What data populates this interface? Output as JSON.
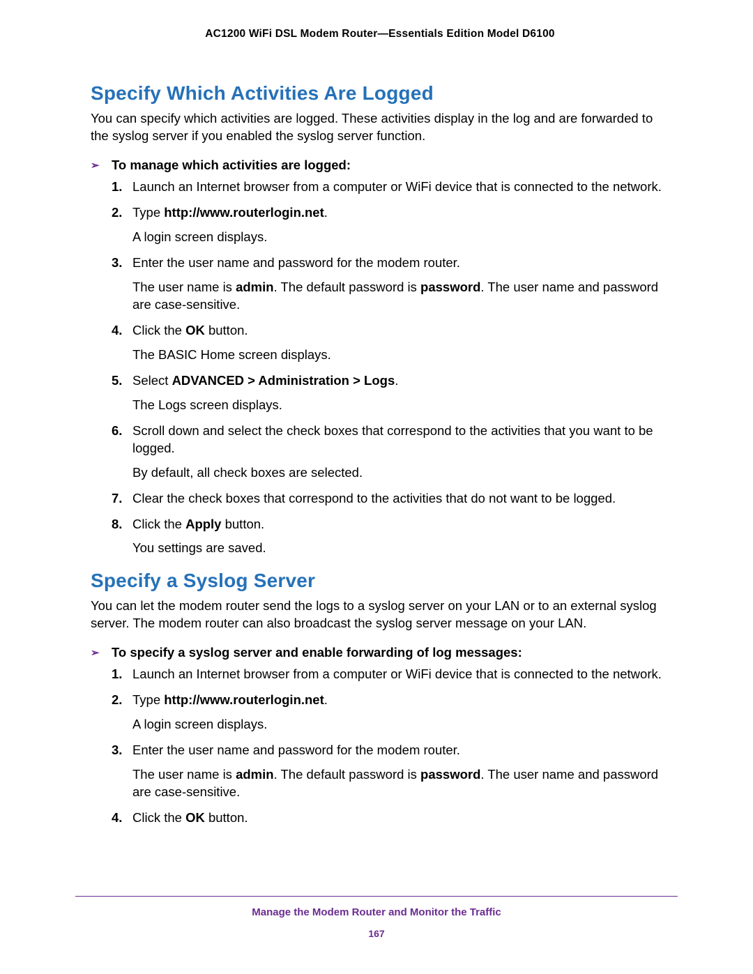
{
  "header": {
    "title": "AC1200 WiFi DSL Modem Router—Essentials Edition Model D6100"
  },
  "section1": {
    "heading": "Specify Which Activities Are Logged",
    "intro": "You can specify which activities are logged. These activities display in the log and are forwarded to the syslog server if you enabled the syslog server function.",
    "proc_heading": "To manage which activities are logged:",
    "steps": [
      {
        "num": "1.",
        "html": "Launch an Internet browser from a computer or WiFi device that is connected to the network.",
        "followups": []
      },
      {
        "num": "2.",
        "html": "Type <span class=\"b\">http://www.routerlogin.net</span>.",
        "followups": [
          "A login screen displays."
        ]
      },
      {
        "num": "3.",
        "html": "Enter the user name and password for the modem router.",
        "followups": [
          "The user name is <span class=\"b\">admin</span>. The default password is <span class=\"b\">password</span>. The user name and password are case-sensitive."
        ]
      },
      {
        "num": "4.",
        "html": "Click the <span class=\"b\">OK</span> button.",
        "followups": [
          "The BASIC Home screen displays."
        ]
      },
      {
        "num": "5.",
        "html": "Select <span class=\"b\">ADVANCED &gt; Administration &gt; Logs</span>.",
        "followups": [
          "The Logs screen displays."
        ]
      },
      {
        "num": "6.",
        "html": "Scroll down and select the check boxes that correspond to the activities that you want to be logged.",
        "followups": [
          "By default, all check boxes are selected."
        ]
      },
      {
        "num": "7.",
        "html": "Clear the check boxes that correspond to the activities that do not want to be logged.",
        "followups": []
      },
      {
        "num": "8.",
        "html": "Click the <span class=\"b\">Apply</span> button.",
        "followups": [
          "You settings are saved."
        ]
      }
    ]
  },
  "section2": {
    "heading": "Specify a Syslog Server",
    "intro": "You can let the modem router send the logs to a syslog server on your LAN or to an external syslog server. The modem router can also broadcast the syslog server message on your LAN.",
    "proc_heading": "To specify a syslog server and enable forwarding of log messages:",
    "steps": [
      {
        "num": "1.",
        "html": "Launch an Internet browser from a computer or WiFi device that is connected to the network.",
        "followups": []
      },
      {
        "num": "2.",
        "html": "Type <span class=\"b\">http://www.routerlogin.net</span>.",
        "followups": [
          "A login screen displays."
        ]
      },
      {
        "num": "3.",
        "html": "Enter the user name and password for the modem router.",
        "followups": [
          "The user name is <span class=\"b\">admin</span>. The default password is <span class=\"b\">password</span>. The user name and password are case-sensitive."
        ]
      },
      {
        "num": "4.",
        "html": "Click the <span class=\"b\">OK</span> button.",
        "followups": []
      }
    ]
  },
  "footer": {
    "chapter": "Manage the Modem Router and Monitor the Traffic",
    "page": "167"
  }
}
